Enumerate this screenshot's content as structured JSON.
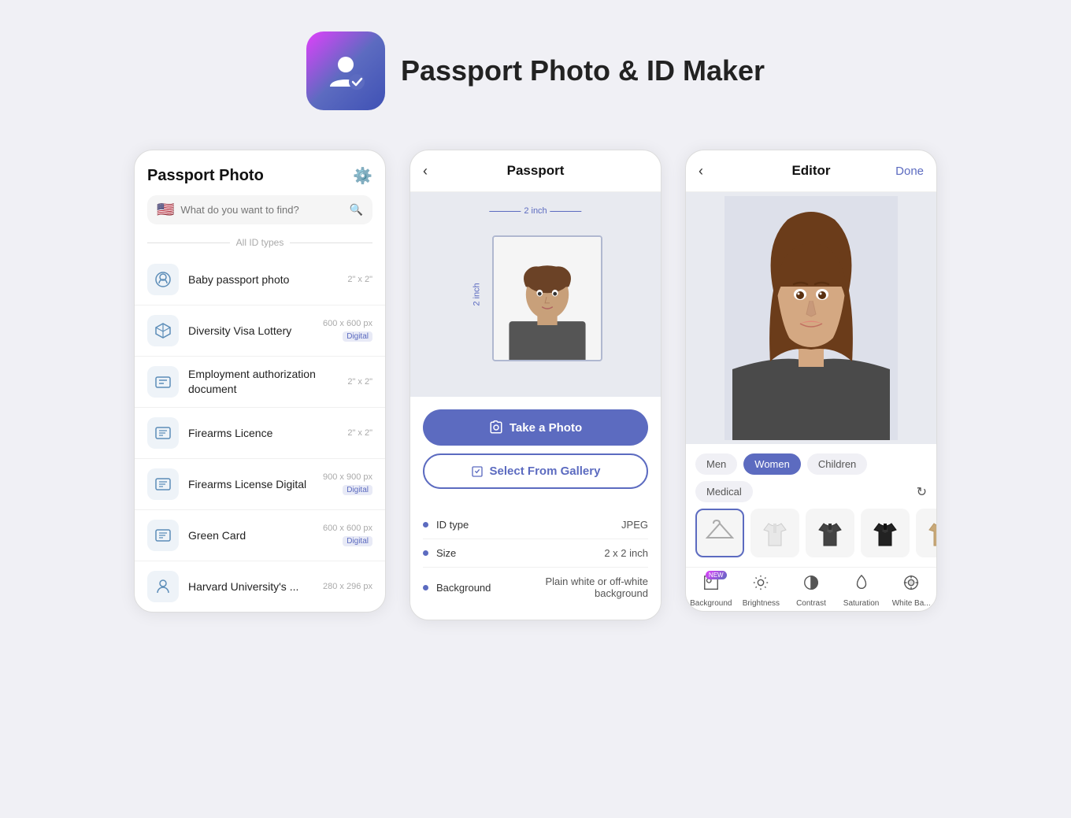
{
  "app": {
    "title": "Passport Photo & ID Maker"
  },
  "phone1": {
    "header_title": "Passport Photo",
    "search_placeholder": "What do you want to find?",
    "divider_label": "All ID types",
    "items": [
      {
        "name": "Baby passport photo",
        "size": "2\" x 2\"",
        "badge": null,
        "icon": "👶"
      },
      {
        "name": "Diversity Visa Lottery",
        "size": "600 x 600 px",
        "badge": "Digital",
        "icon": "✈️"
      },
      {
        "name": "Employment authorization document",
        "size": "2\" x 2\"",
        "badge": null,
        "icon": "💼"
      },
      {
        "name": "Firearms Licence",
        "size": "2\" x 2\"",
        "badge": null,
        "icon": "📋"
      },
      {
        "name": "Firearms License Digital",
        "size": "900 x 900 px",
        "badge": "Digital",
        "icon": "📋"
      },
      {
        "name": "Green Card",
        "size": "600 x 600 px",
        "badge": "Digital",
        "icon": "📋"
      },
      {
        "name": "Harvard University's ...",
        "size": "280 x 296 px",
        "badge": null,
        "icon": "🎓"
      }
    ]
  },
  "phone2": {
    "header_title": "Passport",
    "dimension_h": "2 inch",
    "dimension_v": "2 inch",
    "btn_photo": "Take a Photo",
    "btn_gallery": "Select From Gallery",
    "info_items": [
      {
        "label": "ID type",
        "value": "JPEG"
      },
      {
        "label": "Size",
        "value": "2 x 2 inch"
      },
      {
        "label": "Background",
        "value": "Plain white or off-white background"
      }
    ]
  },
  "phone3": {
    "header_title": "Editor",
    "done_label": "Done",
    "categories": [
      "Men",
      "Women",
      "Children",
      "Medical"
    ],
    "active_category": "Women",
    "toolbar": [
      {
        "label": "Background",
        "badge": "NEW"
      },
      {
        "label": "Brightness"
      },
      {
        "label": "Contrast"
      },
      {
        "label": "Saturation"
      },
      {
        "label": "White Ba..."
      }
    ],
    "white_label": "White"
  }
}
